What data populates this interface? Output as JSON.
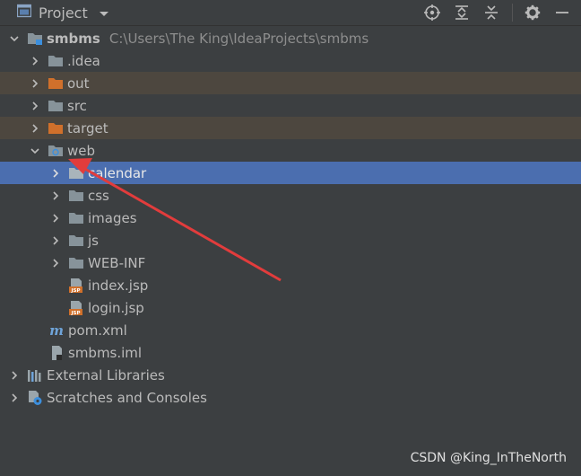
{
  "panel": {
    "title": "Project"
  },
  "tree": {
    "root": {
      "name": "smbms",
      "path": "C:\\Users\\The King\\IdeaProjects\\smbms"
    },
    "items": [
      {
        "label": ".idea"
      },
      {
        "label": "out"
      },
      {
        "label": "src"
      },
      {
        "label": "target"
      },
      {
        "label": "web"
      },
      {
        "label": "calendar"
      },
      {
        "label": "css"
      },
      {
        "label": "images"
      },
      {
        "label": "js"
      },
      {
        "label": "WEB-INF"
      },
      {
        "label": "index.jsp"
      },
      {
        "label": "login.jsp"
      },
      {
        "label": "pom.xml"
      },
      {
        "label": "smbms.iml"
      },
      {
        "label": "External Libraries"
      },
      {
        "label": "Scratches and Consoles"
      }
    ]
  },
  "icons": {
    "folder": "folder-icon",
    "jsp": "jsp-file-icon",
    "maven": "maven-icon",
    "module_file": "module-file-icon"
  },
  "colors": {
    "background": "#3c3f41",
    "selection": "#4b6eaf",
    "excluded": "#4d473f",
    "folder": "#87939a",
    "excluded_folder": "#d0702b",
    "annotation_arrow": "#e23c3c"
  },
  "watermark": "CSDN @King_InTheNorth"
}
